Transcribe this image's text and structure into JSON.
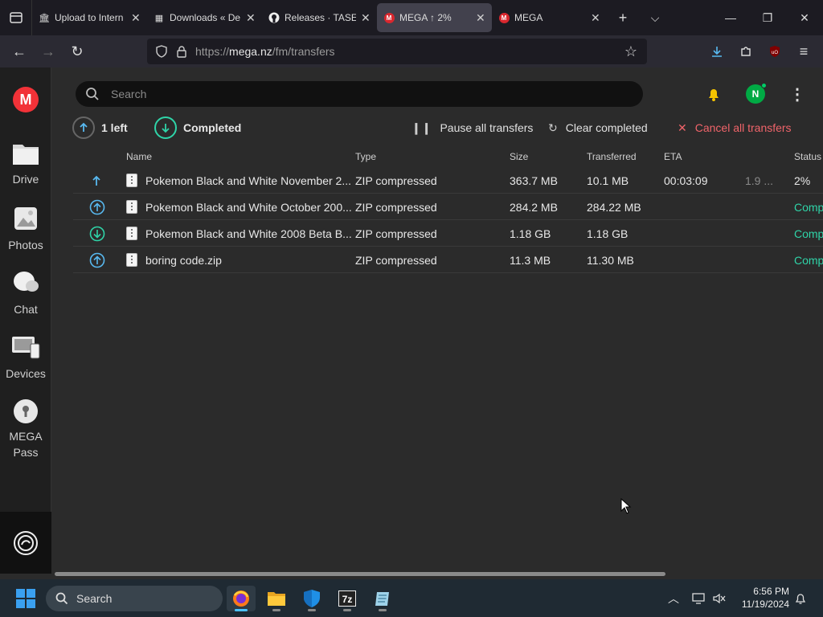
{
  "browser": {
    "tabs": [
      {
        "label": "Upload to Intern",
        "icon": "archive-org-icon"
      },
      {
        "label": "Downloads « De",
        "icon": "site-icon"
      },
      {
        "label": "Releases · TASEr",
        "icon": "github-icon"
      },
      {
        "label": "MEGA ↑ 2%",
        "icon": "mega-icon",
        "active": true
      },
      {
        "label": "MEGA",
        "icon": "mega-icon"
      }
    ],
    "url_scheme": "https://",
    "url_host": "mega.nz",
    "url_path": "/fm/transfers"
  },
  "sidebar": {
    "logo": "M",
    "items": [
      {
        "label": "Drive"
      },
      {
        "label": "Photos"
      },
      {
        "label": "Chat"
      },
      {
        "label": "Devices"
      },
      {
        "label": "MEGA",
        "label2": "Pass"
      }
    ]
  },
  "header": {
    "search_placeholder": "Search",
    "avatar_initial": "N"
  },
  "transfers_status": {
    "left_label": "1 left",
    "completed_label": "Completed",
    "pause_all": "Pause all transfers",
    "clear_completed": "Clear completed",
    "cancel_all": "Cancel all transfers"
  },
  "table": {
    "columns": {
      "name": "Name",
      "type": "Type",
      "size": "Size",
      "transferred": "Transferred",
      "eta": "ETA",
      "status": "Status"
    },
    "rows": [
      {
        "direction": "upload-arrow",
        "name": "Pokemon Black and White November 2...",
        "type": "ZIP compressed",
        "size": "363.7 MB",
        "transferred": "10.1 MB",
        "eta": "00:03:09",
        "speed": "1.9 ...",
        "status": "2%",
        "status_kind": "progress"
      },
      {
        "direction": "upload-circle",
        "name": "Pokemon Black and White October 200...",
        "type": "ZIP compressed",
        "size": "284.2 MB",
        "transferred": "284.22 MB",
        "eta": "",
        "speed": "",
        "status": "Comp",
        "status_kind": "done"
      },
      {
        "direction": "download-circle",
        "name": "Pokemon Black and White 2008 Beta B...",
        "type": "ZIP compressed",
        "size": "1.18 GB",
        "transferred": "1.18 GB",
        "eta": "",
        "speed": "",
        "status": "Comp",
        "status_kind": "done"
      },
      {
        "direction": "upload-circle",
        "name": "boring code.zip",
        "type": "ZIP compressed",
        "size": "11.3 MB",
        "transferred": "11.30 MB",
        "eta": "",
        "speed": "",
        "status": "Comp",
        "status_kind": "done"
      }
    ]
  },
  "taskbar": {
    "search_label": "Search",
    "time": "6:56 PM",
    "date": "11/19/2024"
  },
  "colors": {
    "mega_red": "#f23238",
    "completed_green": "#2fd4a8",
    "cancel_red": "#f0646a",
    "upload_blue": "#58b9f0"
  }
}
